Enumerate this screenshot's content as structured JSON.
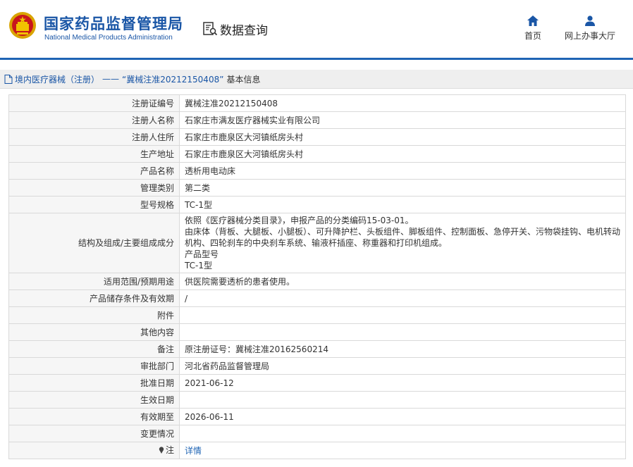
{
  "header": {
    "org_name_cn": "国家药品监督管理局",
    "org_name_en": "National Medical Products Administration",
    "section_title": "数据查询",
    "nav": [
      {
        "label": "首页",
        "icon": "home-icon"
      },
      {
        "label": "网上办事大厅",
        "icon": "user-icon"
      }
    ]
  },
  "breadcrumb": {
    "category": "境内医疗器械（注册）",
    "separator": "——",
    "record": "“冀械注准20212150408”",
    "suffix": "基本信息"
  },
  "details": [
    {
      "key": "注册证编号",
      "value": "冀械注准20212150408"
    },
    {
      "key": "注册人名称",
      "value": "石家庄市满友医疗器械实业有限公司"
    },
    {
      "key": "注册人住所",
      "value": "石家庄市鹿泉区大河镇纸房头村"
    },
    {
      "key": "生产地址",
      "value": "石家庄市鹿泉区大河镇纸房头村"
    },
    {
      "key": "产品名称",
      "value": "透析用电动床"
    },
    {
      "key": "管理类别",
      "value": "第二类"
    },
    {
      "key": "型号规格",
      "value": "TC-1型"
    },
    {
      "key": "结构及组成/主要组成成分",
      "value": "依照《医疗器械分类目录》，申报产品的分类编码15-03-01。\n由床体（背板、大腿板、小腿板）、可升降护栏、头板组件、脚板组件、控制面板、急停开关、污物袋挂钩、电机转动机构、四轮刹车的中央刹车系统、输液杆插座、称重器和打印机组成。\n产品型号\nTC-1型"
    },
    {
      "key": "适用范围/预期用途",
      "value": "供医院需要透析的患者使用。"
    },
    {
      "key": "产品储存条件及有效期",
      "value": "/"
    },
    {
      "key": "附件",
      "value": ""
    },
    {
      "key": "其他内容",
      "value": ""
    },
    {
      "key": "备注",
      "value": "原注册证号：冀械注准20162560214"
    },
    {
      "key": "审批部门",
      "value": "河北省药品监督管理局"
    },
    {
      "key": "批准日期",
      "value": "2021-06-12"
    },
    {
      "key": "生效日期",
      "value": ""
    },
    {
      "key": "有效期至",
      "value": "2026-06-11"
    },
    {
      "key": "变更情况",
      "value": ""
    },
    {
      "key": "注",
      "value": "详情",
      "icon": "pin-icon"
    }
  ]
}
